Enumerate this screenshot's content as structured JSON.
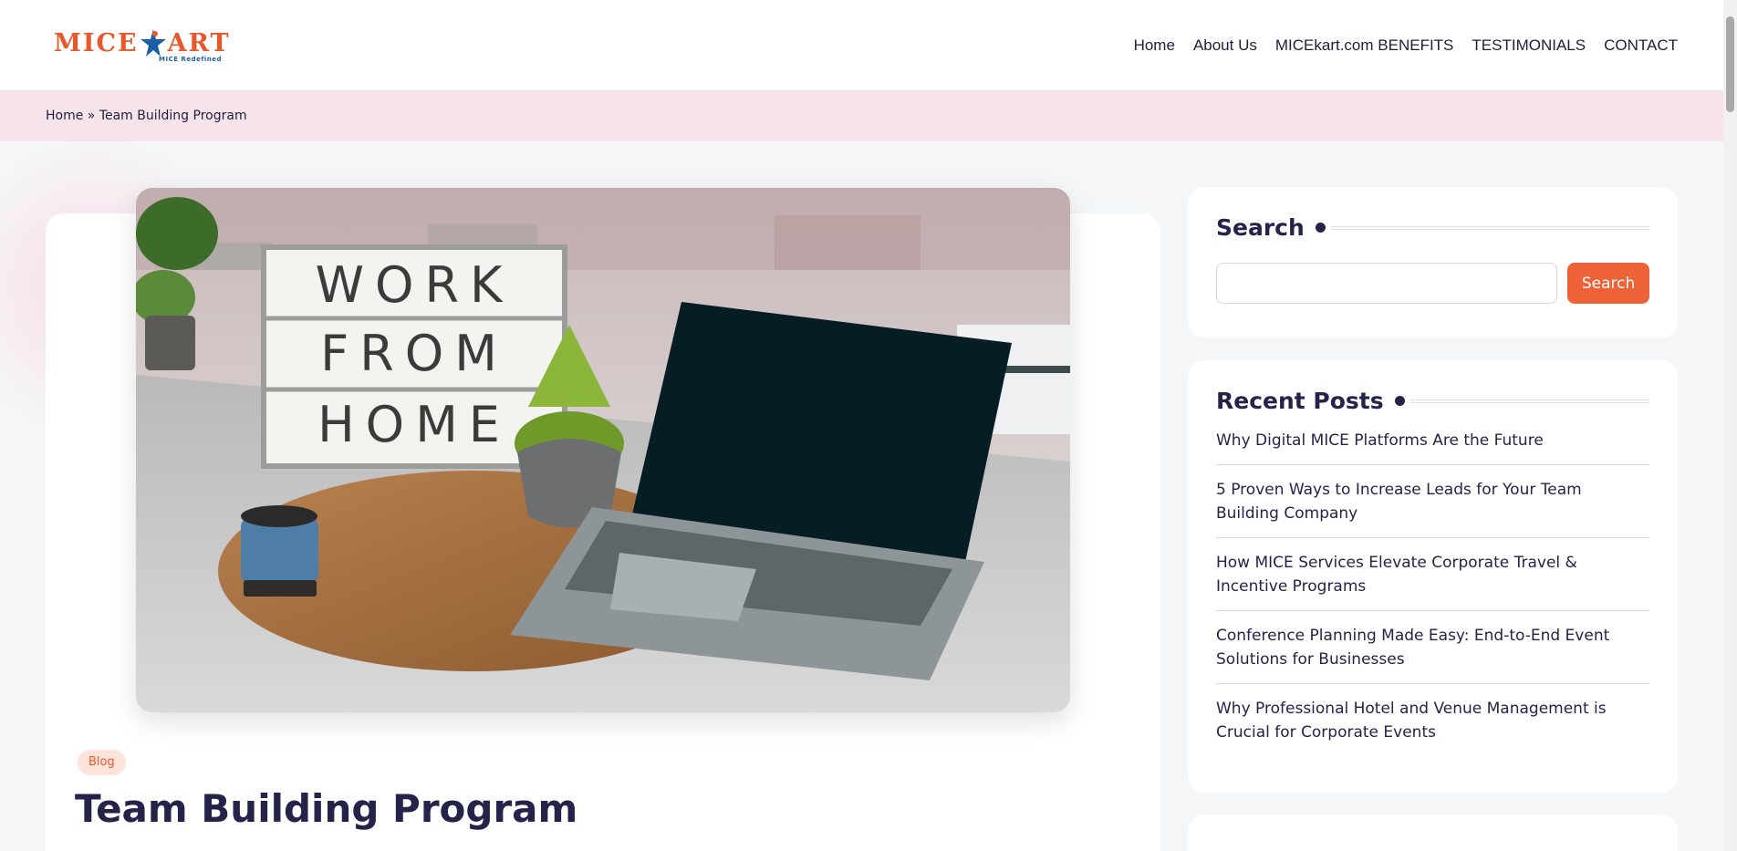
{
  "brand": {
    "logo_text_left": "MICE",
    "logo_text_right": "ART",
    "tagline": "MICE Redefined",
    "colors": {
      "orange": "#e8582a",
      "navy": "#25234a",
      "blue": "#1d5ea8"
    }
  },
  "nav": {
    "items": [
      {
        "label": "Home"
      },
      {
        "label": "About Us"
      },
      {
        "label": "MICEkart.com BENEFITS"
      },
      {
        "label": "TESTIMONIALS"
      },
      {
        "label": "CONTACT"
      }
    ]
  },
  "breadcrumb": {
    "home": "Home",
    "separator": " » ",
    "current": "Team Building Program"
  },
  "article": {
    "hero_image": {
      "sign_lines": [
        "WORK",
        "FROM",
        "HOME"
      ]
    },
    "tag": "Blog",
    "title": "Team Building Program"
  },
  "sidebar": {
    "search": {
      "title": "Search",
      "input_value": "",
      "button_label": "Search"
    },
    "recent_posts": {
      "title": "Recent Posts",
      "items": [
        "Why Digital MICE Platforms Are the Future",
        "5 Proven Ways to Increase Leads for Your Team Building Company",
        "How MICE Services Elevate Corporate Travel & Incentive Programs",
        "Conference Planning Made Easy: End-to-End Event Solutions for Businesses",
        "Why Professional Hotel and Venue Management is Crucial for Corporate Events"
      ]
    },
    "next_widget": {
      "title": ""
    }
  },
  "icons": {
    "logo_star": "running-person-star-icon",
    "widget_dot": "bullet-dot-icon"
  }
}
